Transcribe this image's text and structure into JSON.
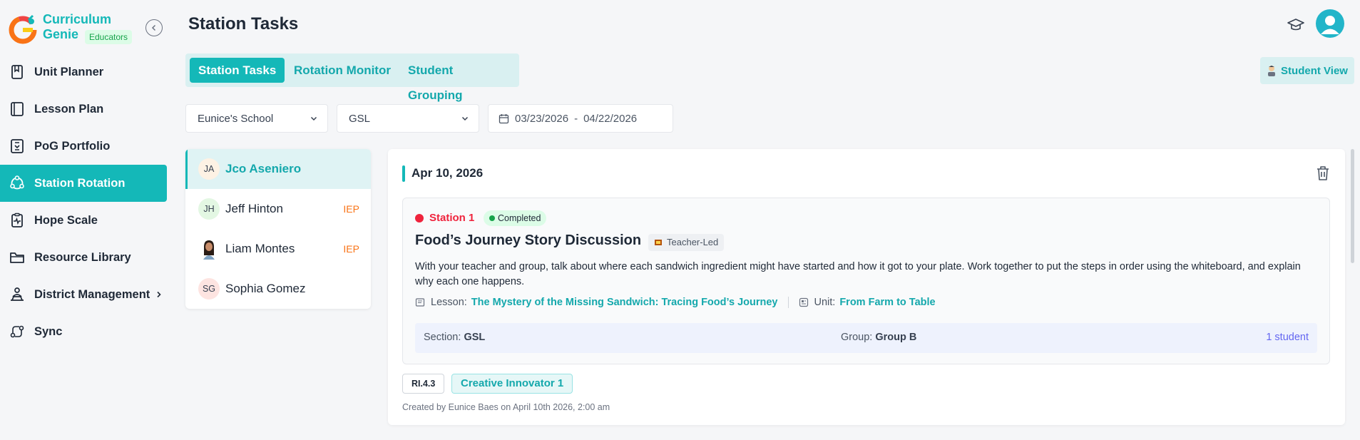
{
  "brand": {
    "name_line1": "Curriculum",
    "name_line2": "Genie",
    "badge": "Educators"
  },
  "sidebar": {
    "items": [
      {
        "label": "Unit Planner",
        "icon": "bookmark-book-icon"
      },
      {
        "label": "Lesson Plan",
        "icon": "open-book-icon"
      },
      {
        "label": "PoG Portfolio",
        "icon": "portfolio-icon"
      },
      {
        "label": "Station Rotation",
        "icon": "rotation-icon",
        "active": true
      },
      {
        "label": "Hope Scale",
        "icon": "clipboard-pulse-icon"
      },
      {
        "label": "Resource Library",
        "icon": "folder-icon"
      },
      {
        "label": "District Management",
        "icon": "district-icon",
        "has_submenu": true
      },
      {
        "label": "Sync",
        "icon": "sync-icon"
      }
    ]
  },
  "header": {
    "title": "Station Tasks"
  },
  "tabs": [
    {
      "label": "Station Tasks",
      "active": true
    },
    {
      "label": "Rotation Monitor"
    },
    {
      "label": "Student Grouping"
    }
  ],
  "student_view_label": "Student View",
  "filters": {
    "school": "Eunice's School",
    "section": "GSL",
    "date_start": "03/23/2026",
    "date_sep": "-",
    "date_end": "04/22/2026"
  },
  "students": [
    {
      "initials": "JA",
      "name": "Jco Aseniero",
      "badge": "",
      "selected": true,
      "avatar_color": "#fdf2e4"
    },
    {
      "initials": "JH",
      "name": "Jeff Hinton",
      "badge": "IEP",
      "avatar_color": "#e3f7e3"
    },
    {
      "initials": "",
      "name": "Liam Montes",
      "badge": "IEP",
      "avatar_color": "#ffffff",
      "photo": true
    },
    {
      "initials": "SG",
      "name": "Sophia Gomez",
      "badge": "",
      "avatar_color": "#fde4e1"
    }
  ],
  "task": {
    "date": "Apr 10, 2026",
    "station": "Station 1",
    "status": "Completed",
    "title": "Food’s Journey Story Discussion",
    "mode": "Teacher-Led",
    "description": "With your teacher and group, talk about where each sandwich ingredient might have started and how it got to your plate. Work together to put the steps in order using the whiteboard, and explain why each one happens.",
    "lesson_label": "Lesson:",
    "lesson": "The Mystery of the Missing Sandwich: Tracing Food’s Journey",
    "unit_label": "Unit:",
    "unit": "From Farm to Table",
    "section_label": "Section:",
    "section": "GSL",
    "group_label": "Group:",
    "group": "Group B",
    "student_count": "1 student",
    "standards": [
      "RI.4.3"
    ],
    "pog": "Creative Innovator 1",
    "created": "Created by Eunice Baes on April 10th 2026, 2:00 am"
  },
  "colors": {
    "accent": "#14b8b8",
    "station": "#ef233c",
    "iep": "#f97316",
    "count": "#6366f1"
  }
}
